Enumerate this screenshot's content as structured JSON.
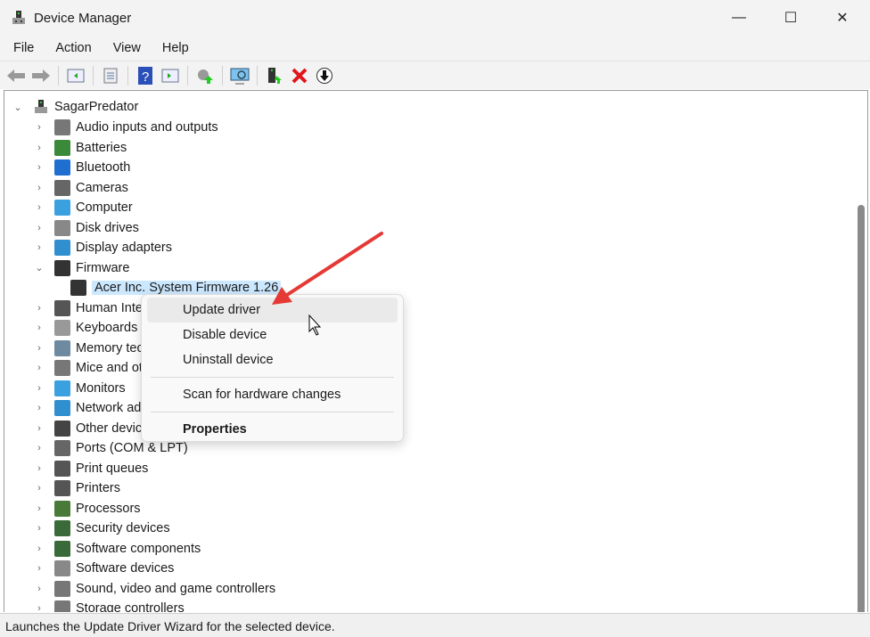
{
  "window": {
    "title": "Device Manager"
  },
  "menu": [
    "File",
    "Action",
    "View",
    "Help"
  ],
  "toolbar": [
    "back-icon",
    "forward-icon",
    "show-hide-console-tree-icon",
    "properties-icon",
    "help-icon",
    "action-pane-icon",
    "update-driver-icon",
    "scan-hardware-icon",
    "enable-device-icon",
    "uninstall-icon",
    "disable-icon"
  ],
  "tree": {
    "root": "SagarPredator",
    "categories": [
      {
        "label": "Audio inputs and outputs",
        "color": "#777"
      },
      {
        "label": "Batteries",
        "color": "#3a8a3a"
      },
      {
        "label": "Bluetooth",
        "color": "#1f6fd1"
      },
      {
        "label": "Cameras",
        "color": "#666"
      },
      {
        "label": "Computer",
        "color": "#3aa0e0"
      },
      {
        "label": "Disk drives",
        "color": "#888"
      },
      {
        "label": "Display adapters",
        "color": "#2f8fcf"
      },
      {
        "label": "Firmware",
        "color": "#333",
        "expanded": true
      },
      {
        "label": "Human Interface Devices",
        "color": "#555"
      },
      {
        "label": "Keyboards",
        "color": "#999"
      },
      {
        "label": "Memory technology devices",
        "color": "#6e8aa0"
      },
      {
        "label": "Mice and other pointing devices",
        "color": "#777"
      },
      {
        "label": "Monitors",
        "color": "#3aa0e0"
      },
      {
        "label": "Network adapters",
        "color": "#2f8fcf"
      },
      {
        "label": "Other devices",
        "color": "#444"
      },
      {
        "label": "Ports (COM & LPT)",
        "color": "#666"
      },
      {
        "label": "Print queues",
        "color": "#555"
      },
      {
        "label": "Printers",
        "color": "#555"
      },
      {
        "label": "Processors",
        "color": "#4a7a3a"
      },
      {
        "label": "Security devices",
        "color": "#3a6a3a"
      },
      {
        "label": "Software components",
        "color": "#3a6a3a"
      },
      {
        "label": "Software devices",
        "color": "#888"
      },
      {
        "label": "Sound, video and game controllers",
        "color": "#777"
      },
      {
        "label": "Storage controllers",
        "color": "#777"
      }
    ],
    "firmware_child": "Acer Inc. System Firmware 1.26"
  },
  "context_menu": {
    "items": [
      "Update driver",
      "Disable device",
      "Uninstall device",
      "Scan for hardware changes",
      "Properties"
    ]
  },
  "status": "Launches the Update Driver Wizard for the selected device.",
  "accent": "#e53935"
}
